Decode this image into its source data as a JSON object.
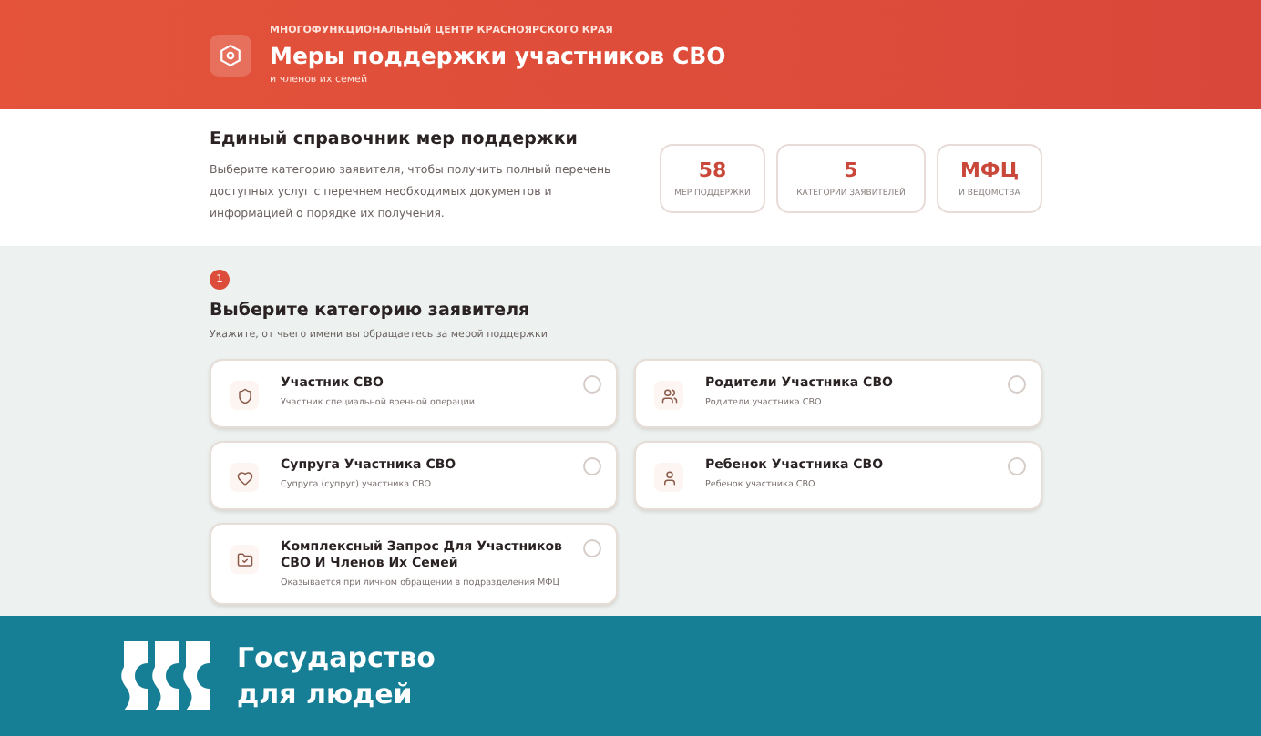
{
  "header": {
    "overline": "МНОГОФУНКЦИОНАЛЬНЫЙ ЦЕНТР КРАСНОЯРСКОГО КРАЯ",
    "title": "Меры поддержки участников СВО",
    "subtitle": "и членов их семей"
  },
  "intro": {
    "title": "Единый справочник мер поддержки",
    "text": "Выберите категорию заявителя, чтобы получить полный перечень доступных услуг с перечнем необходимых документов и информацией о порядке их получения.",
    "stats": [
      {
        "value": "58",
        "label": "МЕР ПОДДЕРЖКИ"
      },
      {
        "value": "5",
        "label": "КАТЕГОРИИ ЗАЯВИТЕЛЕЙ"
      },
      {
        "value": "МФЦ",
        "label": "И ВЕДОМСТВА"
      }
    ]
  },
  "step": {
    "number": "1",
    "title": "Выберите категорию заявителя",
    "hint": "Укажите, от чьего имени вы обращаетесь за мерой поддержки",
    "categories": [
      {
        "kind": "shield",
        "title": "Участник СВО",
        "text": "Участник специальной военной операции",
        "selected": false
      },
      {
        "kind": "users",
        "title": "Родители Участника СВО",
        "text": "Родители участника СВО",
        "selected": false
      },
      {
        "kind": "heart",
        "title": "Супруга Участника СВО",
        "text": "Супруга (супруг) участника СВО",
        "selected": false
      },
      {
        "kind": "user",
        "title": "Ребенок Участника СВО",
        "text": "Ребенок участника СВО",
        "selected": false
      },
      {
        "kind": "folder",
        "title": "Комплексный Запрос Для Участников СВО И Членов Их Семей",
        "text": "Оказывается при личном обращении в подразделения МФЦ",
        "selected": false
      }
    ]
  },
  "banner": {
    "lines": [
      "Государство",
      "для людей"
    ]
  }
}
